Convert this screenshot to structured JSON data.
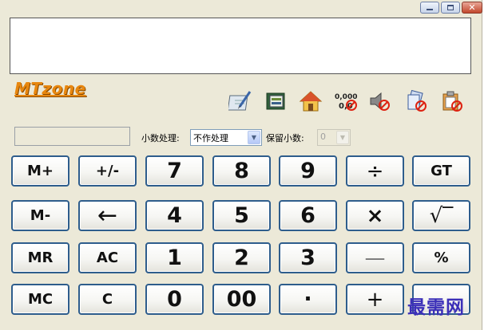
{
  "window": {
    "controls": {
      "minimize": "minimize-icon",
      "maximize": "maximize-icon",
      "close": "close-icon"
    }
  },
  "display": {
    "value": ""
  },
  "logo": "MTzone",
  "toolbar": {
    "icons": [
      "note-edit-icon",
      "book-icon",
      "home-icon",
      "number-format-icon",
      "sound-off-icon",
      "copy-disabled-icon",
      "paste-disabled-icon"
    ]
  },
  "memory_indicator": {
    "value": ""
  },
  "decimal": {
    "label": "小数处理:",
    "value": "不作处理"
  },
  "keep": {
    "label": "保留小数:",
    "value": "0"
  },
  "keys": {
    "m_plus": "M+",
    "plus_minus": "+/-",
    "seven": "7",
    "eight": "8",
    "nine": "9",
    "divide": "÷",
    "gt": "GT",
    "m_minus": "M-",
    "backspace": "←",
    "four": "4",
    "five": "5",
    "six": "6",
    "multiply": "×",
    "sqrt": "√‾",
    "mr": "MR",
    "ac": "AC",
    "one": "1",
    "two": "2",
    "three": "3",
    "minus": "—",
    "percent": "%",
    "mc": "MC",
    "c": "C",
    "zero": "0",
    "double_zero": "00",
    "dot": "·",
    "plus": "+"
  },
  "watermark": "最需网",
  "colors": {
    "accent": "#e8870f",
    "key_border": "#2e5d8c",
    "window_bg": "#ece9d8"
  }
}
